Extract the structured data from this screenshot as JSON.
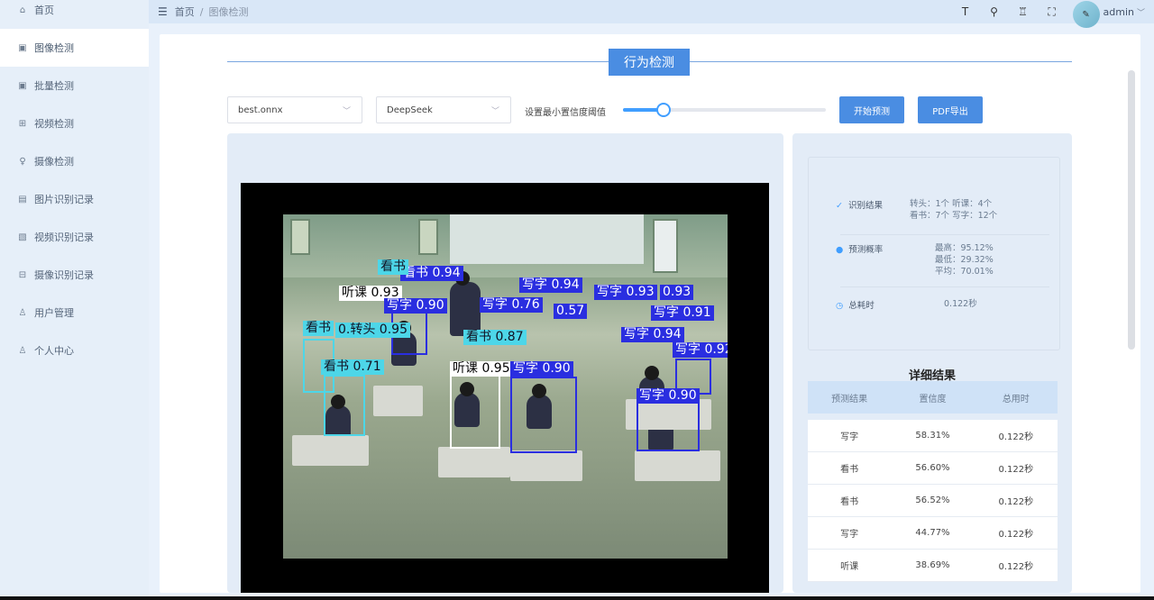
{
  "sidebar": {
    "items": [
      {
        "label": "首页",
        "icon": "home-icon",
        "glyph": "⌂"
      },
      {
        "label": "图像检测",
        "icon": "image-icon",
        "glyph": "▣"
      },
      {
        "label": "批量检测",
        "icon": "batch-icon",
        "glyph": "▣"
      },
      {
        "label": "视频检测",
        "icon": "video-icon",
        "glyph": "⊞"
      },
      {
        "label": "摄像检测",
        "icon": "camera-icon",
        "glyph": "♀"
      },
      {
        "label": "图片识别记录",
        "icon": "image-record-icon",
        "glyph": "▤"
      },
      {
        "label": "视频识别记录",
        "icon": "video-record-icon",
        "glyph": "▧"
      },
      {
        "label": "摄像识别记录",
        "icon": "camera-record-icon",
        "glyph": "⊟"
      },
      {
        "label": "用户管理",
        "icon": "user-icon",
        "glyph": "♙"
      },
      {
        "label": "个人中心",
        "icon": "profile-icon",
        "glyph": "♙"
      }
    ]
  },
  "header": {
    "breadcrumb": {
      "home": "首页",
      "sep": "/",
      "current": "图像检测"
    },
    "icons": [
      {
        "name": "font-size-icon",
        "glyph": "T"
      },
      {
        "name": "search-icon",
        "glyph": "⚲"
      },
      {
        "name": "theme-icon",
        "glyph": "♖"
      },
      {
        "name": "fullscreen-icon",
        "glyph": "⛶"
      }
    ],
    "user": "admin"
  },
  "main": {
    "title": "行为检测",
    "model_select": "best.onnx",
    "ai_select": "DeepSeek",
    "threshold_label": "设置最小置信度阈值",
    "threshold": 0.2,
    "predict_button": "开始预测",
    "export_button": "PDF导出"
  },
  "detections": [
    {
      "label": "看书 0.94",
      "color": "blue"
    },
    {
      "label": "看书",
      "color": "cyan"
    },
    {
      "label": "听课 0.93",
      "color": "white"
    },
    {
      "label": "写字 0.90",
      "color": "blue"
    },
    {
      "label": "写字 0.76",
      "color": "blue"
    },
    {
      "label": "写字 0.94",
      "color": "blue"
    },
    {
      "label": "0.57",
      "color": "blue"
    },
    {
      "label": "写字 0.93",
      "color": "blue"
    },
    {
      "label": "0.93",
      "color": "blue"
    },
    {
      "label": "写字 0.91",
      "color": "blue"
    },
    {
      "label": "看书",
      "color": "cyan"
    },
    {
      "label": "0.转头 0.95",
      "color": "cyan"
    },
    {
      "label": "看书 0.87",
      "color": "cyan"
    },
    {
      "label": "写字 0.94",
      "color": "blue"
    },
    {
      "label": "写字 0.92",
      "color": "blue"
    },
    {
      "label": "看书 0.71",
      "color": "cyan"
    },
    {
      "label": "听课 0.95",
      "color": "white"
    },
    {
      "label": "写字 0.90",
      "color": "blue"
    },
    {
      "label": "写字 0.90",
      "color": "blue"
    }
  ],
  "summary": {
    "result_label": "识别结果",
    "result_line1": "转头：1个   听课：4个",
    "result_line2": "看书：7个   写字：12个",
    "prob_label": "预测概率",
    "prob_max": "最高：95.12%",
    "prob_min": "最低：29.32%",
    "prob_avg": "平均：70.01%",
    "time_label": "总耗时",
    "time_value": "0.122秒"
  },
  "detail": {
    "title": "详细结果",
    "columns": [
      "预测结果",
      "置信度",
      "总用时"
    ],
    "rows": [
      [
        "写字",
        "58.31%",
        "0.122秒"
      ],
      [
        "看书",
        "56.60%",
        "0.122秒"
      ],
      [
        "看书",
        "56.52%",
        "0.122秒"
      ],
      [
        "写字",
        "44.77%",
        "0.122秒"
      ],
      [
        "听课",
        "38.69%",
        "0.122秒"
      ]
    ]
  }
}
